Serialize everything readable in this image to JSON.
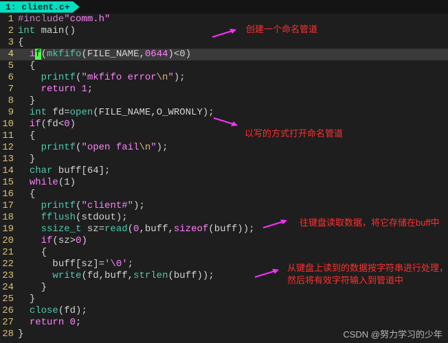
{
  "tab": {
    "label": "1: client.c+"
  },
  "gutter": [
    "1",
    "2",
    "3",
    "4",
    "5",
    "6",
    "7",
    "8",
    "9",
    "10",
    "11",
    "12",
    "13",
    "14",
    "15",
    "16",
    "17",
    "18",
    "19",
    "20",
    "21",
    "22",
    "23",
    "24",
    "25",
    "26",
    "27",
    "28"
  ],
  "annotations": {
    "a1": "创建一个命名管道",
    "a2": "以写的方式打开命名管道",
    "a3": "往键盘读取数据，将它存储在buff中",
    "a4a": "从键盘上读到的数据按字符串进行处理，",
    "a4b": "然后将有效字符输入到管道中"
  },
  "watermark": "CSDN @努力学习的少年",
  "tok": {
    "include": "#include",
    "comm_h": "\"comm.h\"",
    "int": "int",
    "main": " main()",
    "lb": "{",
    "rb": "}",
    "if": "if",
    "mkfifo": "mkfifo",
    "FILE_NAME": "FILE_NAME",
    "c0644": "0644",
    "lt0": "<0",
    "printf": "printf",
    "s_mkfifo_err": "\"mkfifo error",
    "bsn": "\\n",
    "qend": "\"",
    "return": "return",
    "one": "1",
    "zero": "0",
    "fd_eq": " fd=",
    "open": "open",
    "O_WRONLY": "O_WRONLY",
    "if_fd_lt0": "(fd<",
    "s_open_fail": "\"open fail",
    "char": "char",
    "buff64": " buff[64];",
    "while": "while",
    "one_p": "(1)",
    "s_client": "\"client#\"",
    "fflush": "fflush",
    "stdout": "stdout",
    "ssize_t": "ssize_t",
    "sz_eq": " sz=",
    "read": "read",
    "buff": "buff",
    "sizeof": "sizeof",
    "buffp": "(buff)",
    "if_sz_gt0": "(sz>",
    "buff_sz": "buff[sz]=",
    "nul": "'\\0'",
    "write": "write",
    "fd": "fd",
    "strlen": "strlen",
    "close": "close",
    "minus_arrow": " "
  }
}
